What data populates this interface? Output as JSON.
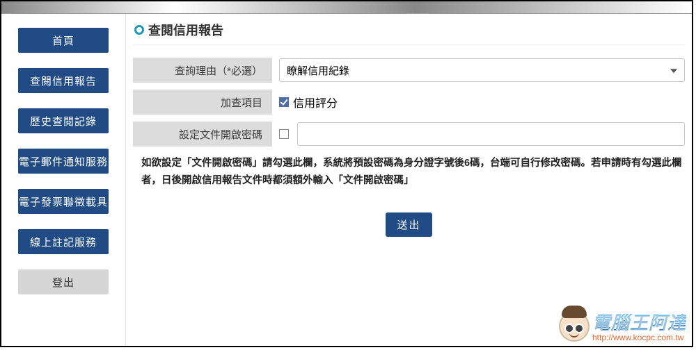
{
  "sidebar": {
    "items": [
      {
        "label": "首頁"
      },
      {
        "label": "查閱信用報告"
      },
      {
        "label": "歷史查閱記錄"
      },
      {
        "label": "電子郵件通知服務"
      },
      {
        "label": "電子發票聯徵載具"
      },
      {
        "label": "線上註記服務"
      }
    ],
    "logout_label": "登出"
  },
  "main": {
    "section_title": "查閱信用報告",
    "form": {
      "reason_label": "查詢理由（*必選）",
      "reason_value": "瞭解信用紀錄",
      "addons_label": "加查項目",
      "addons_option": "信用評分",
      "password_label": "設定文件開啟密碼"
    },
    "note": "如欲設定「文件開啟密碼」請勾選此欄，系統將預設密碼為身分證字號後6碼，台端可自行修改密碼。若申請時有勾選此欄者，日後開啟信用報告文件時都須額外輸入「文件開啟密碼」",
    "submit_label": "送出"
  },
  "watermark": {
    "title": "電腦王阿達",
    "url": "http://www.kocpc.com.tw"
  }
}
